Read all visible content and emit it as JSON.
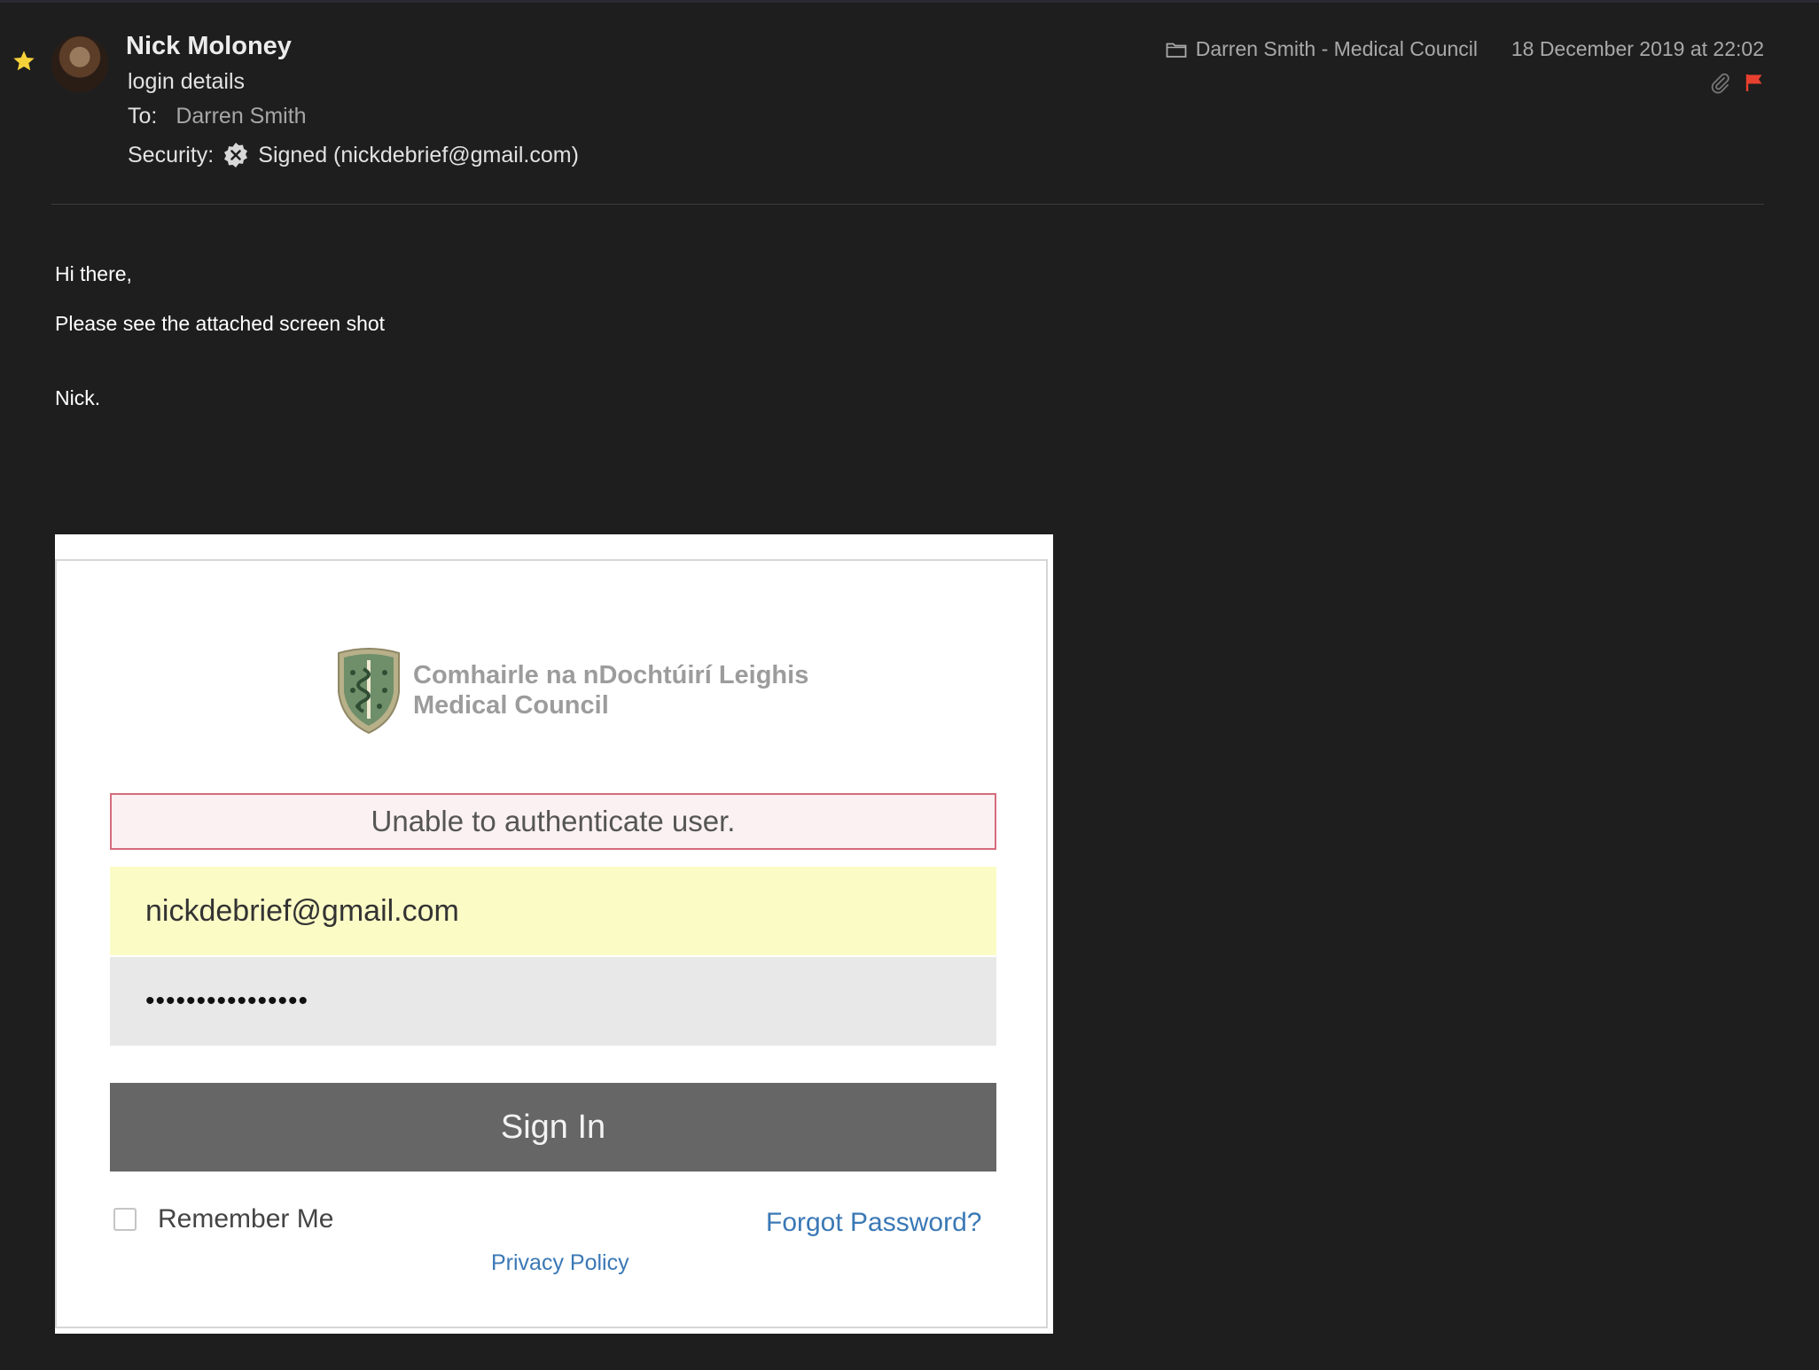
{
  "message": {
    "sender_name": "Nick Moloney",
    "subject": "login details",
    "to_label": "To:",
    "to_value": "Darren Smith",
    "security_label": "Security:",
    "security_value": "Signed (nickdebrief@gmail.com)",
    "folder": "Darren Smith - Medical Council",
    "date": "18 December 2019 at 22:02",
    "flag_color": "#e8402f",
    "star_color": "#f6d23a"
  },
  "body": {
    "greeting": "Hi there,",
    "line1": "Please see the attached screen shot",
    "signoff": "Nick."
  },
  "attachment": {
    "logo_line1": "Comhairle na nDochtúirí Leighis",
    "logo_line2": "Medical Council",
    "error_message": "Unable to authenticate user.",
    "email_value": "nickdebrief@gmail.com",
    "password_value": "••••••••••••••••",
    "signin_label": "Sign In",
    "remember_label": "Remember Me",
    "forgot_label": "Forgot Password?",
    "privacy_label": "Privacy Policy"
  }
}
